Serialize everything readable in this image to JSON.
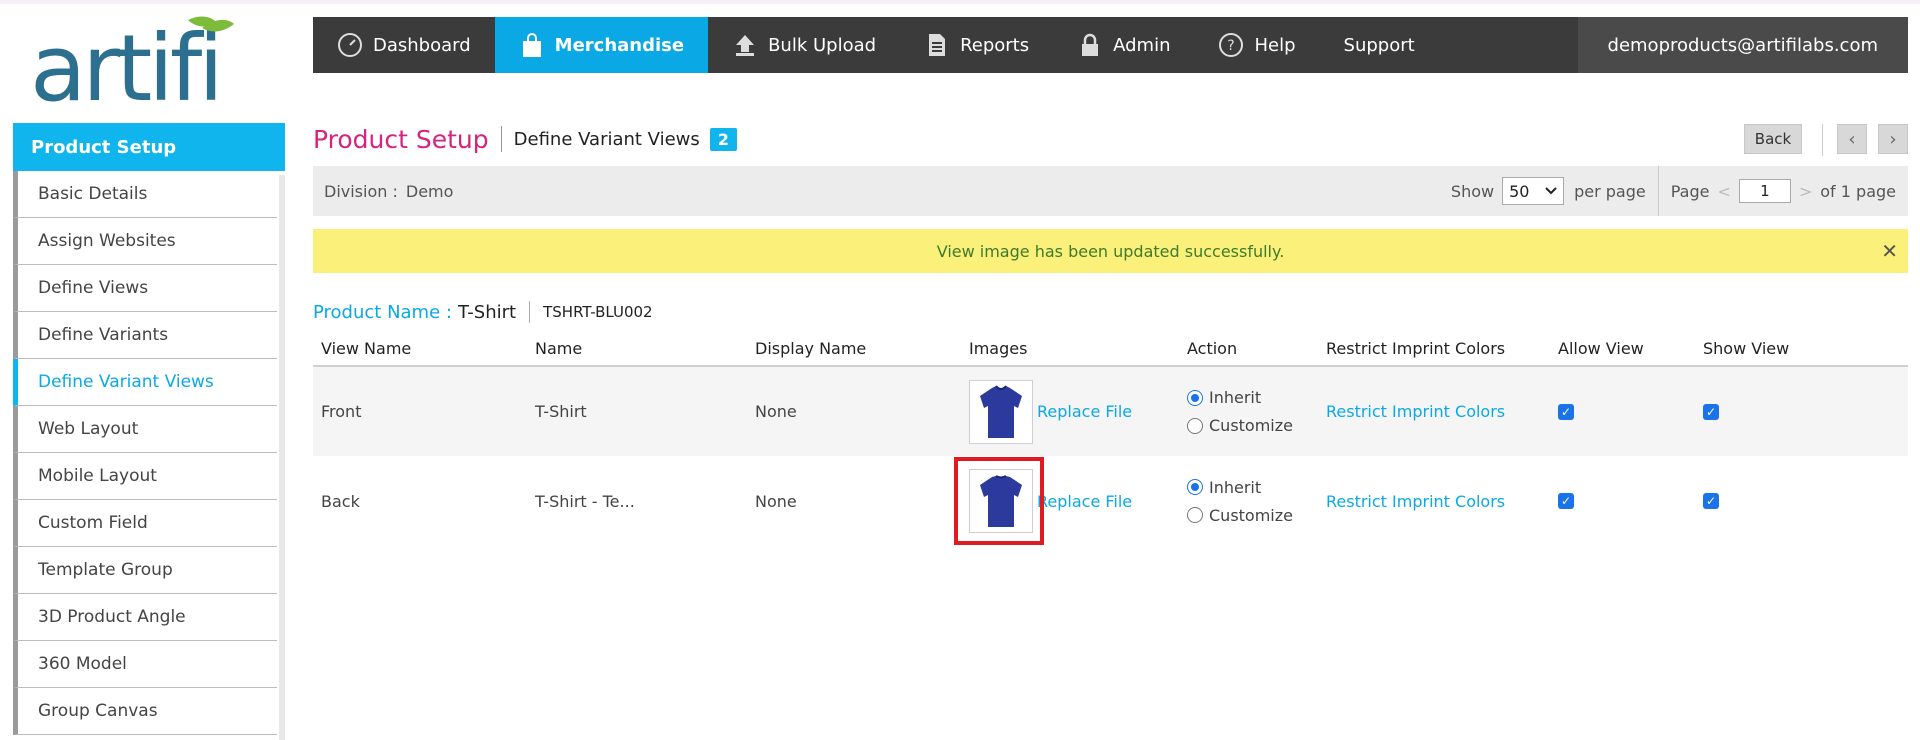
{
  "logo": {
    "text": "artifi",
    "color_main": "#2c6f8e",
    "color_leaf": "#7dbb3a"
  },
  "topnav": {
    "items": [
      {
        "label": "Dashboard",
        "icon": "dashboard-gauge-icon"
      },
      {
        "label": "Merchandise",
        "icon": "shopping-bag-icon",
        "active": true
      },
      {
        "label": "Bulk Upload",
        "icon": "upload-icon"
      },
      {
        "label": "Reports",
        "icon": "document-icon"
      },
      {
        "label": "Admin",
        "icon": "lock-icon"
      },
      {
        "label": "Help",
        "icon": "help-icon"
      },
      {
        "label": "Support"
      }
    ],
    "user_email": "demoproducts@artifilabs.com"
  },
  "sidebar": {
    "header": "Product Setup",
    "items": [
      {
        "label": "Basic Details"
      },
      {
        "label": "Assign Websites"
      },
      {
        "label": "Define Views"
      },
      {
        "label": "Define Variants"
      },
      {
        "label": "Define Variant Views",
        "active": true
      },
      {
        "label": "Web Layout"
      },
      {
        "label": "Mobile Layout"
      },
      {
        "label": "Custom Field"
      },
      {
        "label": "Template Group"
      },
      {
        "label": "3D Product Angle"
      },
      {
        "label": "360 Model"
      },
      {
        "label": "Group Canvas"
      }
    ]
  },
  "page": {
    "title": "Product Setup",
    "subtitle": "Define Variant Views",
    "badge": "2",
    "back_label": "Back",
    "prev_glyph": "‹",
    "next_glyph": "›"
  },
  "filter": {
    "division_label": "Division :",
    "division_value": "Demo",
    "show_label": "Show",
    "per_page_value": "50",
    "per_page_label": "per page",
    "page_label": "Page",
    "page_value": "1",
    "of_pages": "of 1 page"
  },
  "alert": {
    "message": "View image has been updated successfully.",
    "close": "✕"
  },
  "product": {
    "name_label": "Product Name :",
    "name_value": "T-Shirt",
    "sku": "TSHRT-BLU002"
  },
  "table": {
    "headers": [
      "View Name",
      "Name",
      "Display Name",
      "Images",
      "Action",
      "Restrict Imprint Colors",
      "Allow View",
      "Show View"
    ],
    "rows": [
      {
        "view_name": "Front",
        "name": "T-Shirt",
        "display_name": "None",
        "image_link": "Replace File",
        "action_inherit": "Inherit",
        "action_customize": "Customize",
        "restrict_link": "Restrict Imprint Colors",
        "allow": true,
        "show": true
      },
      {
        "view_name": "Back",
        "name": "T-Shirt - Te...",
        "display_name": "None",
        "image_link": "Replace File",
        "action_inherit": "Inherit",
        "action_customize": "Customize",
        "restrict_link": "Restrict Imprint Colors",
        "allow": true,
        "show": true
      }
    ]
  },
  "colors": {
    "accent": "#10b5ee",
    "title": "#d6237f",
    "nav_bg": "#3b3b3b",
    "alert_bg": "#fbf07a",
    "shirt": "#2b3a9c"
  }
}
